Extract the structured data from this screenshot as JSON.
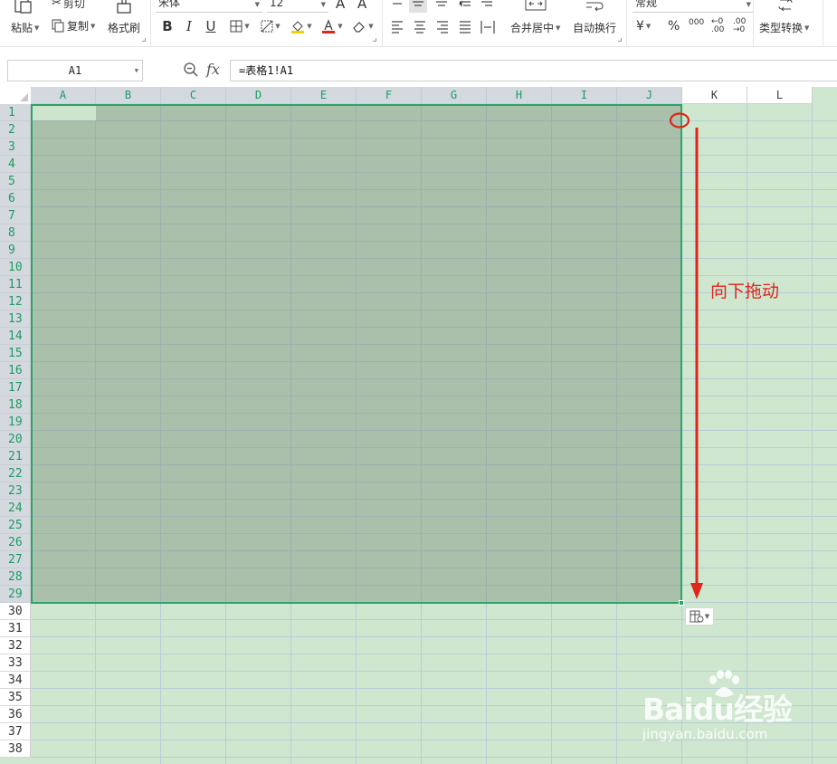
{
  "ribbon": {
    "paste": "粘贴",
    "cut": "剪切",
    "copy": "复制",
    "format_painter": "格式刷",
    "font_name": "宋体",
    "font_size": "12",
    "bold": "B",
    "italic": "I",
    "underline": "U",
    "grow_font": "A",
    "shrink_font": "A",
    "merge_center": "合并居中",
    "wrap_text": "自动换行",
    "number_format": "常规",
    "currency": "¥",
    "percent": "%",
    "thousands": "000",
    "increase_decimal": ".00",
    "decrease_decimal": ".00",
    "type_convert": "类型转换"
  },
  "formula_bar": {
    "name_box": "A1",
    "fx_label": "fx",
    "formula": "=表格1!A1"
  },
  "sheet": {
    "columns": [
      "A",
      "B",
      "C",
      "D",
      "E",
      "F",
      "G",
      "H",
      "I",
      "J",
      "K",
      "L"
    ],
    "selected_columns": [
      "A",
      "B",
      "C",
      "D",
      "E",
      "F",
      "G",
      "H",
      "I",
      "J"
    ],
    "rows": [
      "1",
      "2",
      "3",
      "4",
      "5",
      "6",
      "7",
      "8",
      "9",
      "10",
      "11",
      "12",
      "13",
      "14",
      "15",
      "16",
      "17",
      "18",
      "19",
      "20",
      "21",
      "22",
      "23",
      "24",
      "25",
      "26",
      "27",
      "28",
      "29",
      "30",
      "31",
      "32",
      "33",
      "34",
      "35",
      "36",
      "37",
      "38"
    ],
    "selected_range": "A1:J29",
    "active_cell": "A1"
  },
  "annotation": {
    "text": "向下拖动",
    "color": "#e0251b"
  },
  "watermark": {
    "main": "Baidu经验",
    "sub": "jingyan.baidu.com"
  },
  "colors": {
    "sheet_background": "#cfe6cf",
    "selection_border": "#2aa56b",
    "header_selected_text": "#1d9a63"
  }
}
